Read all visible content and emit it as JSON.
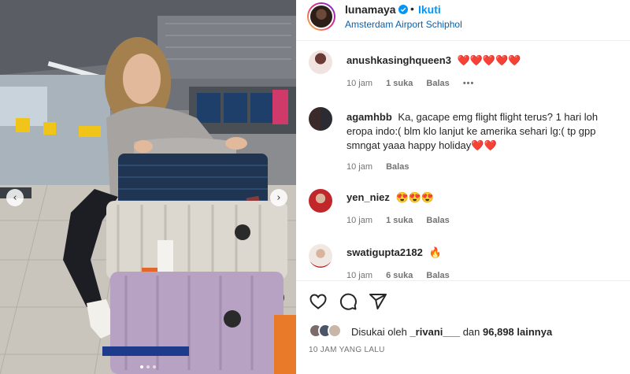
{
  "post": {
    "username": "lunamaya",
    "follow_label": "Ikuti",
    "location": "Amsterdam Airport Schiphol",
    "dot": "•"
  },
  "photo": {
    "prev_icon": "chevron-left-icon",
    "next_icon": "chevron-right-icon",
    "prev_glyph": "‹",
    "next_glyph": "›"
  },
  "comments": [
    {
      "username": "anushkasinghqueen3",
      "text": "❤️❤️❤️❤️❤️",
      "time": "10 jam",
      "likes": "1 suka",
      "reply": "Balas",
      "more": "•••"
    },
    {
      "username": "agamhbb",
      "text": "Ka, gacape emg flight flight terus? 1 hari loh eropa indo:( blm klo lanjut ke amerika sehari lg:( tp gpp smngat yaaa happy holiday❤️❤️",
      "time": "10 jam",
      "reply": "Balas"
    },
    {
      "username": "yen_niez",
      "text": "😍😍😍",
      "time": "10 jam",
      "likes": "1 suka",
      "reply": "Balas"
    },
    {
      "username": "swatigupta2182",
      "text": "🔥",
      "time": "10 jam",
      "likes": "6 suka",
      "reply": "Balas"
    }
  ],
  "actions": {
    "like_icon": "heart-icon",
    "comment_icon": "comment-icon",
    "share_icon": "share-icon"
  },
  "likes": {
    "prefix": "Disukai oleh",
    "user": "_rivani___",
    "middle": "dan",
    "count": "96,898 lainnya"
  },
  "time_ago": "10 JAM YANG LALU",
  "colors": {
    "accent": "#0095f6",
    "heart": "#e0243a",
    "muted": "#737373"
  }
}
